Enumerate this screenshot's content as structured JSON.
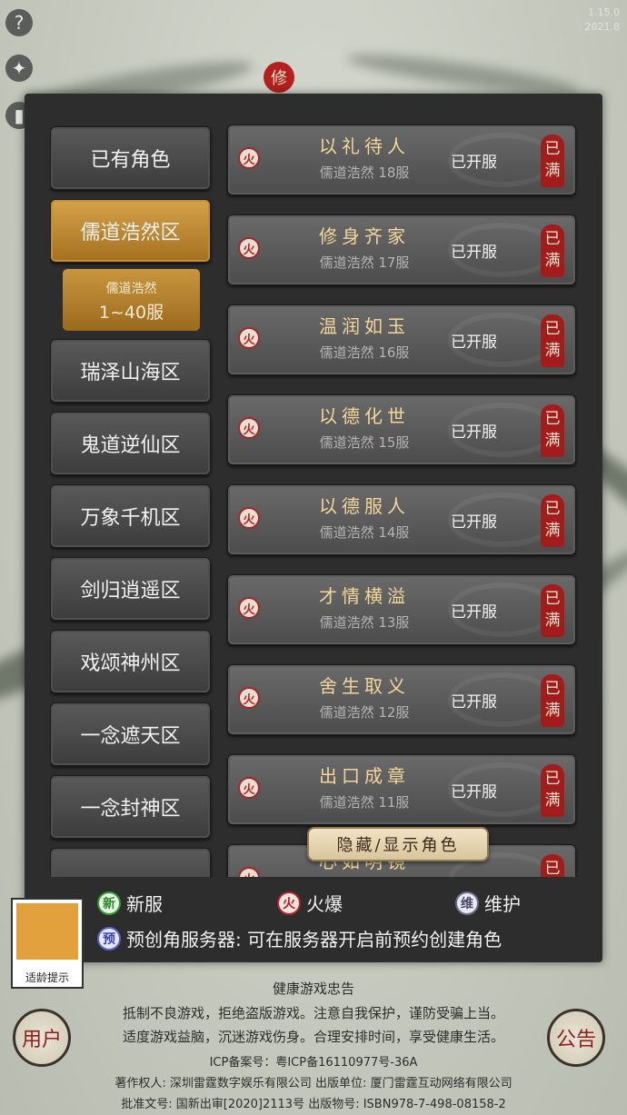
{
  "top": {
    "help_icon": "?",
    "tools_icon": "✦",
    "signal_icon": "▮",
    "seal_char": "修",
    "top_right_line1": "1.15.0",
    "top_right_line2": "2021.8"
  },
  "zones": [
    {
      "label": "已有角色",
      "active": false
    },
    {
      "label": "儒道浩然区",
      "active": true
    },
    {
      "label": "瑞泽山海区",
      "active": false
    },
    {
      "label": "鬼道逆仙区",
      "active": false
    },
    {
      "label": "万象千机区",
      "active": false
    },
    {
      "label": "剑归逍遥区",
      "active": false
    },
    {
      "label": "戏颂神州区",
      "active": false
    },
    {
      "label": "一念遮天区",
      "active": false
    },
    {
      "label": "一念封神区",
      "active": false
    }
  ],
  "subzone": {
    "line1": "儒道浩然",
    "line2": "1~40服"
  },
  "servers": [
    {
      "name": "以礼待人",
      "sub": "儒道浩然 18服",
      "status": "已开服",
      "badge": "火",
      "full": "已满"
    },
    {
      "name": "修身齐家",
      "sub": "儒道浩然 17服",
      "status": "已开服",
      "badge": "火",
      "full": "已满"
    },
    {
      "name": "温润如玉",
      "sub": "儒道浩然 16服",
      "status": "已开服",
      "badge": "火",
      "full": "已满"
    },
    {
      "name": "以德化世",
      "sub": "儒道浩然 15服",
      "status": "已开服",
      "badge": "火",
      "full": "已满"
    },
    {
      "name": "以德服人",
      "sub": "儒道浩然 14服",
      "status": "已开服",
      "badge": "火",
      "full": "已满"
    },
    {
      "name": "才情横溢",
      "sub": "儒道浩然 13服",
      "status": "已开服",
      "badge": "火",
      "full": "已满"
    },
    {
      "name": "舍生取义",
      "sub": "儒道浩然 12服",
      "status": "已开服",
      "badge": "火",
      "full": "已满"
    },
    {
      "name": "出口成章",
      "sub": "儒道浩然 11服",
      "status": "已开服",
      "badge": "火",
      "full": "已满"
    },
    {
      "name": "心如明镜",
      "sub": "",
      "status": "",
      "badge": "火",
      "full": "已满"
    }
  ],
  "toggle_label": "隐藏/显示角色",
  "legend": {
    "new_icon": "新",
    "new_label": "新服",
    "hot_icon": "火",
    "hot_label": "火爆",
    "maint_icon": "维",
    "maint_label": "维护",
    "pre_icon": "预",
    "pre_label": "预创角服务器: 可在服务器开启前预约创建角色"
  },
  "age_box_label": "适龄提示",
  "user_button": "用户",
  "notice_button": "公告",
  "footer": {
    "title": "健康游戏忠告",
    "line1": "抵制不良游戏，拒绝盗版游戏。注意自我保护，谨防受骗上当。",
    "line2": "适度游戏益脑，沉迷游戏伤身。合理安排时间，享受健康生活。",
    "icp": "ICP备案号：粤ICP备16110977号-36A",
    "copyright": "著作权人: 深圳雷霆数字娱乐有限公司 出版单位: 厦门雷霆互动网络有限公司",
    "approval": "批准文号: 国新出审[2020]2113号 出版物号: ISBN978-7-498-08158-2"
  }
}
